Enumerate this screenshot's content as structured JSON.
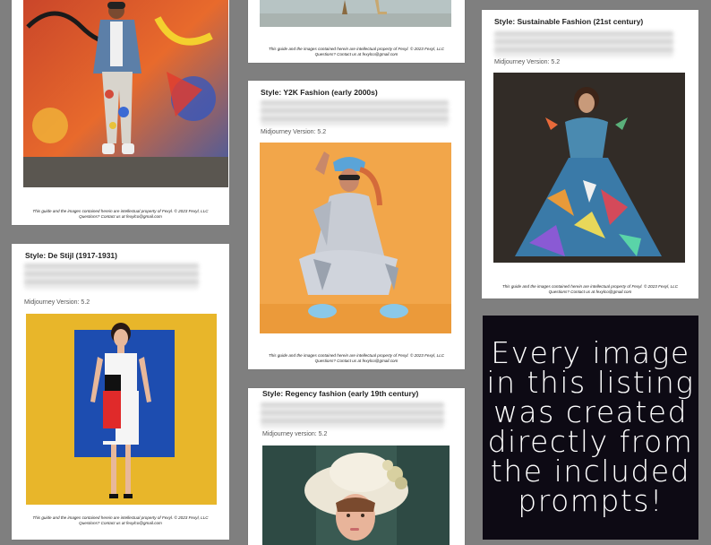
{
  "footer": {
    "line1": "This guide and the images contained herein are intellectual property of Fexyl. © 2023 Fexyl, LLC",
    "line2": "Questions? Contact us at fexylco@gmail.com"
  },
  "cards": {
    "graffiti": {},
    "top_partial": {},
    "sustainable": {
      "title": "Style: Sustainable Fashion (21st century)",
      "version": "Midjourney Version: 5.2"
    },
    "y2k": {
      "title": "Style: Y2K Fashion (early 2000s)",
      "version": "Midjourney Version: 5.2"
    },
    "destijl": {
      "title": "Style: De Stijl (1917-1931)",
      "version": "Midjourney Version: 5.2"
    },
    "regency": {
      "title": "Style: Regency fashion (early 19th century)",
      "version": "Midjourney version: 5.2"
    }
  },
  "promo": {
    "lines": [
      "Every image",
      "in this listing",
      "was created",
      "directly from",
      "the included",
      "prompts!"
    ],
    "background": "#0d0a14"
  },
  "colors": {
    "page_background": "#7f7f7f",
    "card_background": "#ffffff",
    "y2k_backdrop": "#f2a64a",
    "destijl_backdrop": "#e8b62a",
    "destijl_blue": "#1d4db0"
  }
}
